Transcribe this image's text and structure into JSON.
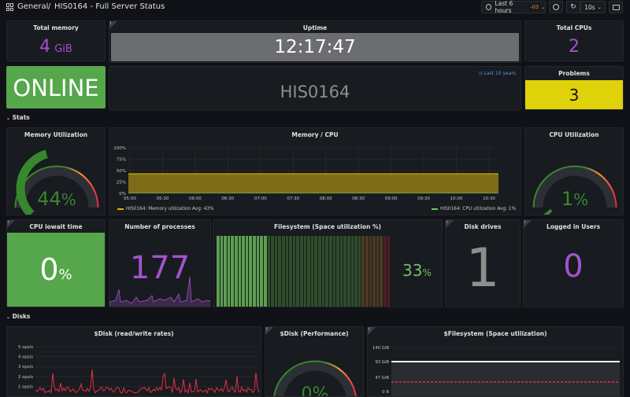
{
  "header": {
    "breadcrumb_root": "General",
    "separator": "/",
    "dashboard_title": "HIS0164 - Full Server Status",
    "time_range": "Last 6 hours",
    "time_offset": "-03",
    "refresh_interval": "10s"
  },
  "panels": {
    "total_memory": {
      "title": "Total memory",
      "value": "4",
      "unit": "GiB"
    },
    "uptime": {
      "title": "Uptime",
      "value": "12:17:47"
    },
    "total_cpus": {
      "title": "Total CPUs",
      "value": "2"
    },
    "status": {
      "value": "ONLINE"
    },
    "hostname": {
      "value": "HIS0164",
      "time_note": "Last 10 years"
    },
    "problems": {
      "title": "Problems",
      "value": "3"
    },
    "memory_util": {
      "title": "Memory Utilization",
      "value": "44",
      "unit": "%",
      "fraction": 0.44
    },
    "memory_cpu": {
      "title": "Memory / CPU",
      "legend_mem": "HIS0164: Memory utilization  Avg: 43%",
      "legend_cpu": "HIS0164: CPU utilization  Avg: 1%"
    },
    "cpu_util": {
      "title": "CPU Utilization",
      "value": "1",
      "unit": "%",
      "fraction": 0.01
    },
    "cpu_iowait": {
      "title": "CPU iowait time",
      "value": "0",
      "unit": "%"
    },
    "processes": {
      "title": "Number of processes",
      "value": "177"
    },
    "filesystem": {
      "title": "Filesystem (Space utilization %)",
      "value": "33",
      "unit": "%"
    },
    "disk_drives": {
      "title": "Disk drives",
      "value": "1"
    },
    "logged_users": {
      "title": "Logged in Users",
      "value": "0"
    },
    "disk_rw": {
      "title": "$Disk (read/write rates)"
    },
    "disk_perf": {
      "title": "$Disk (Performance)",
      "value": "0%"
    },
    "fs_space": {
      "title": "$Filesystem (Space utilization)"
    }
  },
  "sections": {
    "stats": "Stats",
    "disks": "Disks"
  },
  "chart_data": [
    {
      "type": "area",
      "title": "Memory / CPU",
      "x": [
        "05:00",
        "05:30",
        "06:00",
        "06:30",
        "07:00",
        "07:30",
        "08:00",
        "08:30",
        "09:00",
        "09:30",
        "10:00",
        "10:30"
      ],
      "yticks": [
        "0%",
        "25%",
        "50%",
        "75%",
        "100%"
      ],
      "ylim": [
        0,
        100
      ],
      "series": [
        {
          "name": "HIS0164: Memory utilization",
          "avg": 43,
          "color": "#e0b400"
        },
        {
          "name": "HIS0164: CPU utilization",
          "avg": 1,
          "color": "#73bf69"
        }
      ]
    },
    {
      "type": "line",
      "title": "$Disk (read/write rates)",
      "yticks": [
        "1 ops/s",
        "2 ops/s",
        "3 ops/s",
        "4 ops/s",
        "5 ops/s"
      ]
    },
    {
      "type": "line",
      "title": "$Filesystem (Space utilization)",
      "yticks": [
        "140 GiB",
        "93 GiB",
        "47 GiB",
        "0 B"
      ]
    }
  ],
  "colors": {
    "green": "#56a64b",
    "purple": "#a352cc",
    "yellow": "#e0d20a",
    "gauge_green": "#37872d",
    "red": "#e02f44",
    "orange": "#ff9830"
  }
}
